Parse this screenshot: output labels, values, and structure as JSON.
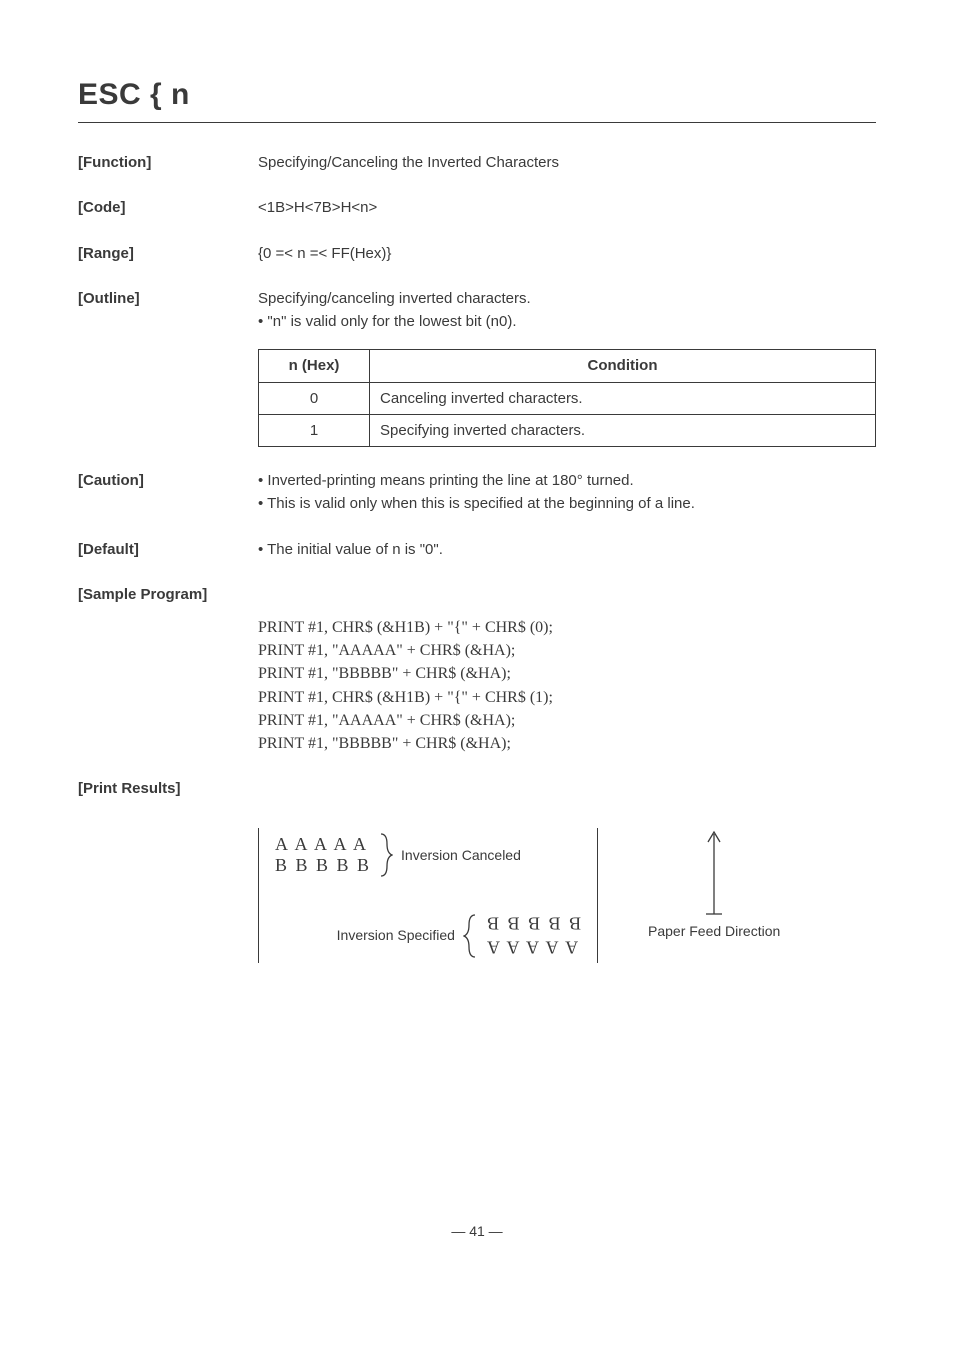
{
  "title": "ESC { n",
  "sections": {
    "function": {
      "label": "[Function]",
      "text": "Specifying/Canceling the Inverted Characters"
    },
    "code": {
      "label": "[Code]",
      "text": "<1B>H<7B>H<n>"
    },
    "range": {
      "label": "[Range]",
      "text": "{0 =< n =< FF(Hex)}"
    },
    "outline": {
      "label": "[Outline]",
      "line1": "Specifying/canceling inverted characters.",
      "line2": "• \"n\" is valid only for the lowest bit (n0)."
    },
    "table": {
      "headers": {
        "nhex": "n (Hex)",
        "condition": "Condition"
      },
      "rows": [
        {
          "n": "0",
          "cond": "Canceling inverted characters."
        },
        {
          "n": "1",
          "cond": "Specifying inverted characters."
        }
      ]
    },
    "caution": {
      "label": "[Caution]",
      "line1": "• Inverted-printing means printing the line at 180° turned.",
      "line2": "• This is valid only when this is specified at the beginning of a line."
    },
    "default": {
      "label": "[Default]",
      "text": "• The initial value of n is \"0\"."
    },
    "sample": {
      "label": "[Sample Program]",
      "code": "PRINT #1, CHR$ (&H1B) + \"{\" + CHR$ (0);\nPRINT #1, \"AAAAA\" + CHR$ (&HA);\nPRINT #1, \"BBBBB\" + CHR$ (&HA);\nPRINT #1, CHR$ (&H1B) + \"{\" + CHR$ (1);\nPRINT #1, \"AAAAA\" + CHR$ (&HA);\nPRINT #1, \"BBBBB\" + CHR$ (&HA);"
    },
    "results": {
      "label": "[Print Results]",
      "canceled_label": "Inversion Canceled",
      "specified_label": "Inversion Specified",
      "letters_a": "A A A A A",
      "letters_b": "B B B B B",
      "paperfeed": "Paper Feed\nDirection"
    }
  },
  "footer": "— 41 —"
}
